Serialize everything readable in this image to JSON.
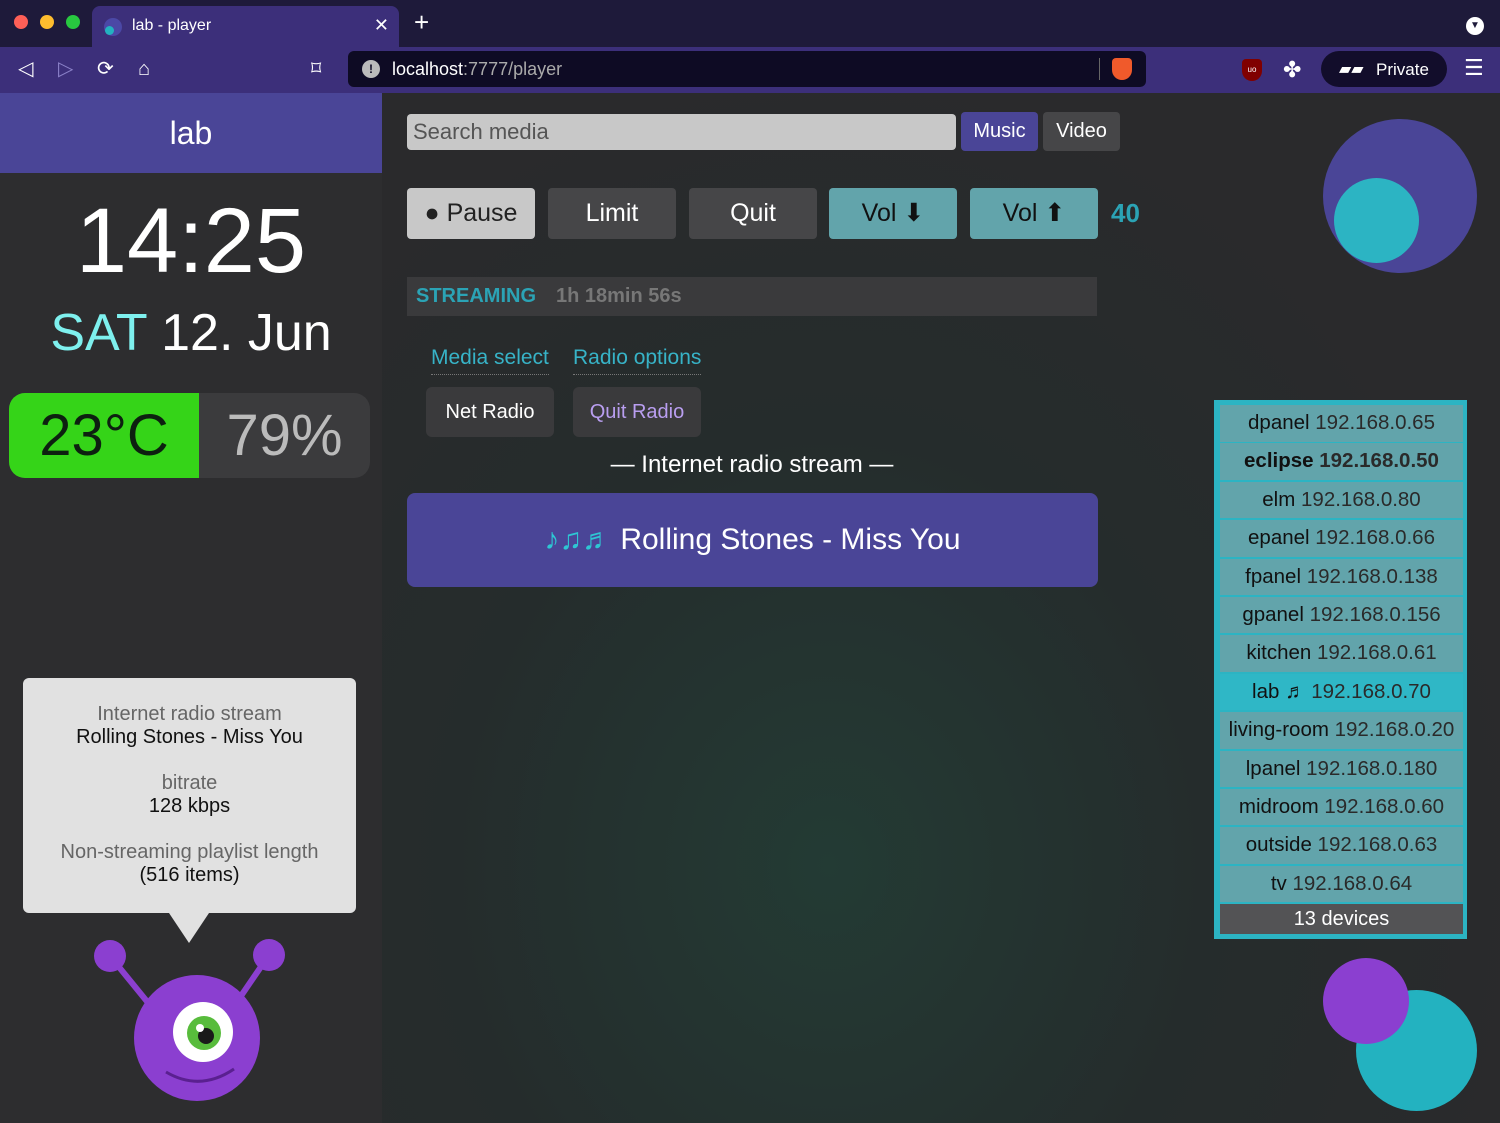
{
  "browser": {
    "tab_title": "lab - player",
    "url_host": "localhost",
    "url_rest": ":7777/player",
    "private_label": "Private"
  },
  "sidebar": {
    "host": "lab",
    "time": "14:25",
    "day": "SAT",
    "date": "12. Jun",
    "temperature": "23°C",
    "humidity": "79%"
  },
  "info_bubble": {
    "stream_type": "Internet radio stream",
    "track": "Rolling Stones - Miss You",
    "bitrate_label": "bitrate",
    "bitrate": "128 kbps",
    "playlist_label": "Non-streaming playlist length",
    "playlist_count": "(516 items)"
  },
  "search": {
    "placeholder": "Search media"
  },
  "mode_buttons": {
    "music": "Music",
    "video": "Video"
  },
  "controls": {
    "pause": "● Pause",
    "limit": "Limit",
    "quit": "Quit",
    "vol_down": "Vol ⬇",
    "vol_up": "Vol ⬆",
    "volume": "40"
  },
  "status": {
    "label": "STREAMING",
    "duration": "1h 18min 56s"
  },
  "tabs": {
    "media_select": "Media select",
    "radio_options": "Radio options"
  },
  "radio": {
    "net_radio": "Net Radio",
    "quit_radio": "Quit Radio",
    "heading": "— Internet radio stream —",
    "notes": "♪♫♬",
    "now_playing": "Rolling Stones - Miss You"
  },
  "devices": {
    "items": [
      {
        "name": "dpanel",
        "ip": "192.168.0.65"
      },
      {
        "name": "eclipse",
        "ip": "192.168.0.50"
      },
      {
        "name": "elm",
        "ip": "192.168.0.80"
      },
      {
        "name": "epanel",
        "ip": "192.168.0.66"
      },
      {
        "name": "fpanel",
        "ip": "192.168.0.138"
      },
      {
        "name": "gpanel",
        "ip": "192.168.0.156"
      },
      {
        "name": "kitchen",
        "ip": "192.168.0.61"
      },
      {
        "name": "lab ♬",
        "ip": "192.168.0.70"
      },
      {
        "name": "living-room",
        "ip": "192.168.0.20"
      },
      {
        "name": "lpanel",
        "ip": "192.168.0.180"
      },
      {
        "name": "midroom",
        "ip": "192.168.0.60"
      },
      {
        "name": "outside",
        "ip": "192.168.0.63"
      },
      {
        "name": "tv",
        "ip": "192.168.0.64"
      }
    ],
    "count": "13 devices"
  },
  "colors": {
    "accent_purple": "#4a4597",
    "accent_teal": "#2ba3b5",
    "temperature_bg": "#35d418"
  }
}
